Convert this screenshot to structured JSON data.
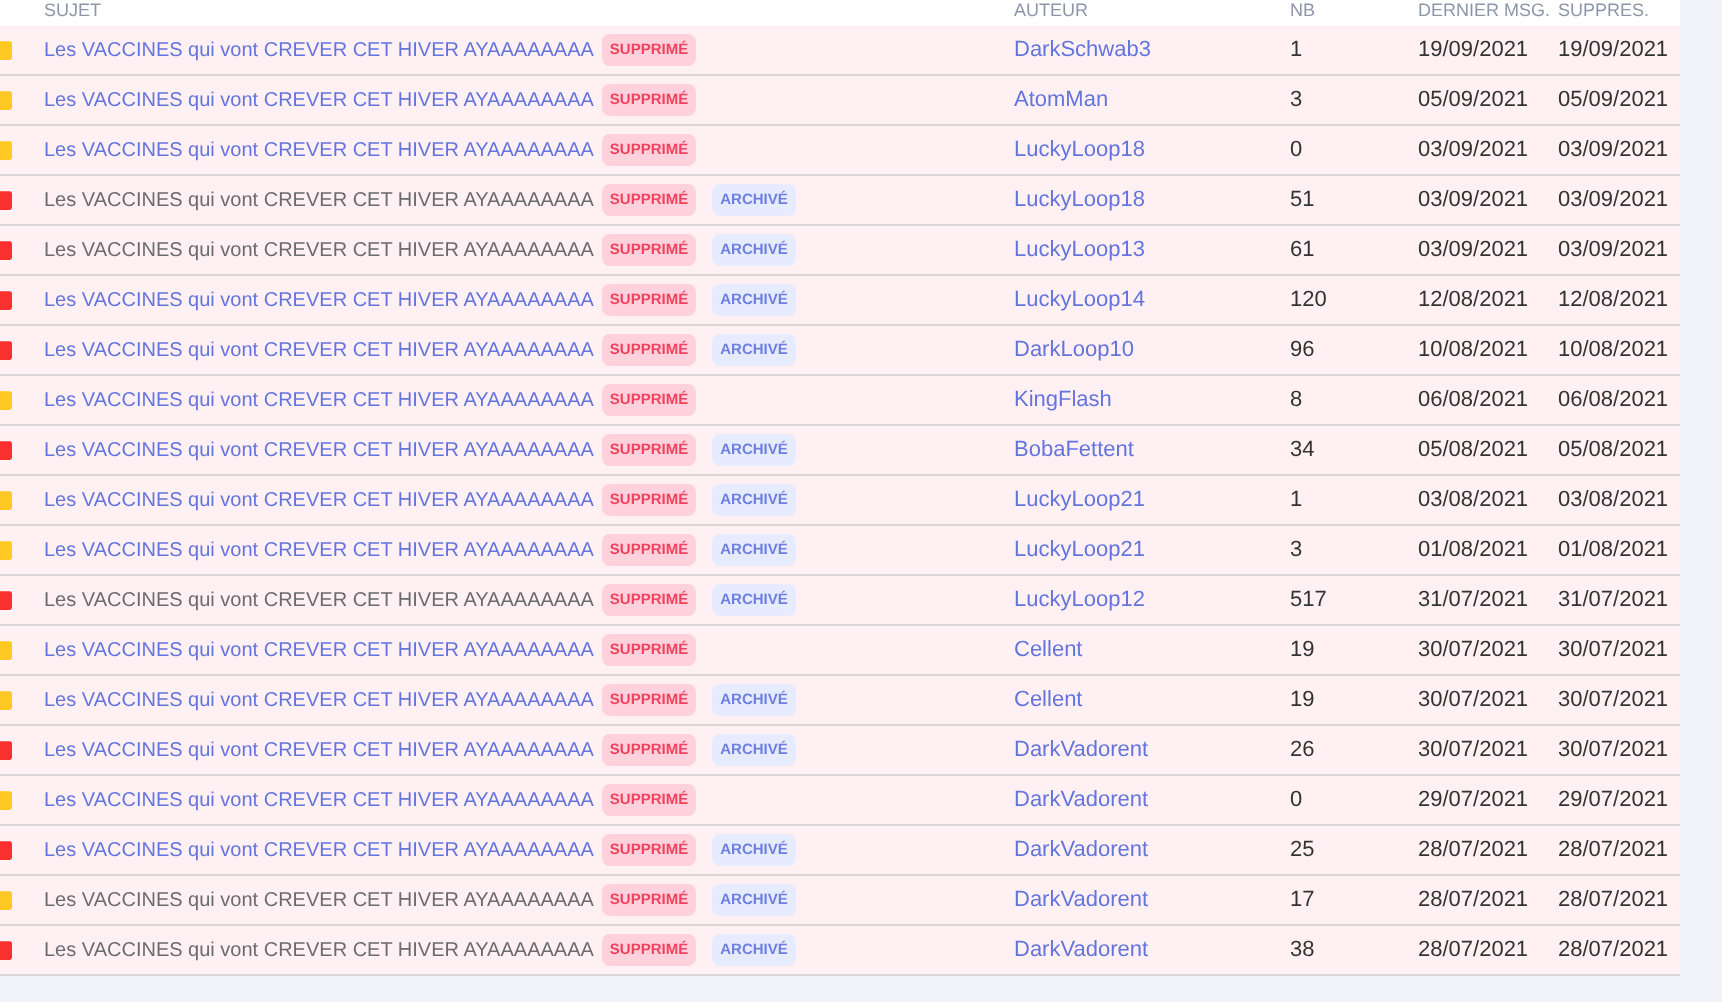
{
  "columns": [
    "SUJET",
    "AUTEUR",
    "NB",
    "DERNIER MSG.",
    "SUPPRES."
  ],
  "rows": [
    {
      "subject": "Les VACCINES qui vont CREVER CET HIVER AYAAAAAAAA",
      "color": "#ffc823",
      "visited": false,
      "tags": [
        {
          "kind": "deleted",
          "label": "SUPPRIMÉ"
        }
      ],
      "author": "DarkSchwab3",
      "nb": "1",
      "last": "19/09/2021",
      "deleted_on": "19/09/2021"
    },
    {
      "subject": "Les VACCINES qui vont CREVER CET HIVER AYAAAAAAAA",
      "color": "#ffc823",
      "visited": false,
      "tags": [
        {
          "kind": "deleted",
          "label": "SUPPRIMÉ"
        }
      ],
      "author": "AtomMan",
      "nb": "3",
      "last": "05/09/2021",
      "deleted_on": "05/09/2021"
    },
    {
      "subject": "Les VACCINES qui vont CREVER CET HIVER AYAAAAAAAA",
      "color": "#ffc823",
      "visited": false,
      "tags": [
        {
          "kind": "deleted",
          "label": "SUPPRIMÉ"
        }
      ],
      "author": "LuckyLoop18",
      "nb": "0",
      "last": "03/09/2021",
      "deleted_on": "03/09/2021"
    },
    {
      "subject": "Les VACCINES qui vont CREVER CET HIVER AYAAAAAAAA",
      "color": "#f8312f",
      "visited": true,
      "tags": [
        {
          "kind": "deleted",
          "label": "SUPPRIMÉ"
        },
        {
          "kind": "archived",
          "label": "ARCHIVÉ"
        }
      ],
      "author": "LuckyLoop18",
      "nb": "51",
      "last": "03/09/2021",
      "deleted_on": "03/09/2021"
    },
    {
      "subject": "Les VACCINES qui vont CREVER CET HIVER AYAAAAAAAA",
      "color": "#f8312f",
      "visited": true,
      "tags": [
        {
          "kind": "deleted",
          "label": "SUPPRIMÉ"
        },
        {
          "kind": "archived",
          "label": "ARCHIVÉ"
        }
      ],
      "author": "LuckyLoop13",
      "nb": "61",
      "last": "03/09/2021",
      "deleted_on": "03/09/2021"
    },
    {
      "subject": "Les VACCINES qui vont CREVER CET HIVER AYAAAAAAAA",
      "color": "#f8312f",
      "visited": false,
      "tags": [
        {
          "kind": "deleted",
          "label": "SUPPRIMÉ"
        },
        {
          "kind": "archived",
          "label": "ARCHIVÉ"
        }
      ],
      "author": "LuckyLoop14",
      "nb": "120",
      "last": "12/08/2021",
      "deleted_on": "12/08/2021"
    },
    {
      "subject": "Les VACCINES qui vont CREVER CET HIVER AYAAAAAAAA",
      "color": "#f8312f",
      "visited": false,
      "tags": [
        {
          "kind": "deleted",
          "label": "SUPPRIMÉ"
        },
        {
          "kind": "archived",
          "label": "ARCHIVÉ"
        }
      ],
      "author": "DarkLoop10",
      "nb": "96",
      "last": "10/08/2021",
      "deleted_on": "10/08/2021"
    },
    {
      "subject": "Les VACCINES qui vont CREVER CET HIVER AYAAAAAAAA",
      "color": "#ffc823",
      "visited": false,
      "tags": [
        {
          "kind": "deleted",
          "label": "SUPPRIMÉ"
        }
      ],
      "author": "KingFlash",
      "nb": "8",
      "last": "06/08/2021",
      "deleted_on": "06/08/2021"
    },
    {
      "subject": "Les VACCINES qui vont CREVER CET HIVER AYAAAAAAAA",
      "color": "#f8312f",
      "visited": false,
      "tags": [
        {
          "kind": "deleted",
          "label": "SUPPRIMÉ"
        },
        {
          "kind": "archived",
          "label": "ARCHIVÉ"
        }
      ],
      "author": "BobaFettent",
      "nb": "34",
      "last": "05/08/2021",
      "deleted_on": "05/08/2021"
    },
    {
      "subject": "Les VACCINES qui vont CREVER CET HIVER AYAAAAAAAA",
      "color": "#ffc823",
      "visited": false,
      "tags": [
        {
          "kind": "deleted",
          "label": "SUPPRIMÉ"
        },
        {
          "kind": "archived",
          "label": "ARCHIVÉ"
        }
      ],
      "author": "LuckyLoop21",
      "nb": "1",
      "last": "03/08/2021",
      "deleted_on": "03/08/2021"
    },
    {
      "subject": "Les VACCINES qui vont CREVER CET HIVER AYAAAAAAAA",
      "color": "#ffc823",
      "visited": false,
      "tags": [
        {
          "kind": "deleted",
          "label": "SUPPRIMÉ"
        },
        {
          "kind": "archived",
          "label": "ARCHIVÉ"
        }
      ],
      "author": "LuckyLoop21",
      "nb": "3",
      "last": "01/08/2021",
      "deleted_on": "01/08/2021"
    },
    {
      "subject": "Les VACCINES qui vont CREVER CET HIVER AYAAAAAAAA",
      "color": "#f8312f",
      "visited": true,
      "tags": [
        {
          "kind": "deleted",
          "label": "SUPPRIMÉ"
        },
        {
          "kind": "archived",
          "label": "ARCHIVÉ"
        }
      ],
      "author": "LuckyLoop12",
      "nb": "517",
      "last": "31/07/2021",
      "deleted_on": "31/07/2021"
    },
    {
      "subject": "Les VACCINES qui vont CREVER CET HIVER AYAAAAAAAA",
      "color": "#ffc823",
      "visited": false,
      "tags": [
        {
          "kind": "deleted",
          "label": "SUPPRIMÉ"
        }
      ],
      "author": "Cellent",
      "nb": "19",
      "last": "30/07/2021",
      "deleted_on": "30/07/2021"
    },
    {
      "subject": "Les VACCINES qui vont CREVER CET HIVER AYAAAAAAAA",
      "color": "#ffc823",
      "visited": false,
      "tags": [
        {
          "kind": "deleted",
          "label": "SUPPRIMÉ"
        },
        {
          "kind": "archived",
          "label": "ARCHIVÉ"
        }
      ],
      "author": "Cellent",
      "nb": "19",
      "last": "30/07/2021",
      "deleted_on": "30/07/2021"
    },
    {
      "subject": "Les VACCINES qui vont CREVER CET HIVER AYAAAAAAAA",
      "color": "#f8312f",
      "visited": false,
      "tags": [
        {
          "kind": "deleted",
          "label": "SUPPRIMÉ"
        },
        {
          "kind": "archived",
          "label": "ARCHIVÉ"
        }
      ],
      "author": "DarkVadorent",
      "nb": "26",
      "last": "30/07/2021",
      "deleted_on": "30/07/2021"
    },
    {
      "subject": "Les VACCINES qui vont CREVER CET HIVER AYAAAAAAAA",
      "color": "#ffc823",
      "visited": false,
      "tags": [
        {
          "kind": "deleted",
          "label": "SUPPRIMÉ"
        }
      ],
      "author": "DarkVadorent",
      "nb": "0",
      "last": "29/07/2021",
      "deleted_on": "29/07/2021"
    },
    {
      "subject": "Les VACCINES qui vont CREVER CET HIVER AYAAAAAAAA",
      "color": "#f8312f",
      "visited": false,
      "tags": [
        {
          "kind": "deleted",
          "label": "SUPPRIMÉ"
        },
        {
          "kind": "archived",
          "label": "ARCHIVÉ"
        }
      ],
      "author": "DarkVadorent",
      "nb": "25",
      "last": "28/07/2021",
      "deleted_on": "28/07/2021"
    },
    {
      "subject": "Les VACCINES qui vont CREVER CET HIVER AYAAAAAAAA",
      "color": "#ffc823",
      "visited": true,
      "tags": [
        {
          "kind": "deleted",
          "label": "SUPPRIMÉ"
        },
        {
          "kind": "archived",
          "label": "ARCHIVÉ"
        }
      ],
      "author": "DarkVadorent",
      "nb": "17",
      "last": "28/07/2021",
      "deleted_on": "28/07/2021"
    },
    {
      "subject": "Les VACCINES qui vont CREVER CET HIVER AYAAAAAAAA",
      "color": "#f8312f",
      "visited": true,
      "tags": [
        {
          "kind": "deleted",
          "label": "SUPPRIMÉ"
        },
        {
          "kind": "archived",
          "label": "ARCHIVÉ"
        }
      ],
      "author": "DarkVadorent",
      "nb": "38",
      "last": "28/07/2021",
      "deleted_on": "28/07/2021"
    }
  ]
}
